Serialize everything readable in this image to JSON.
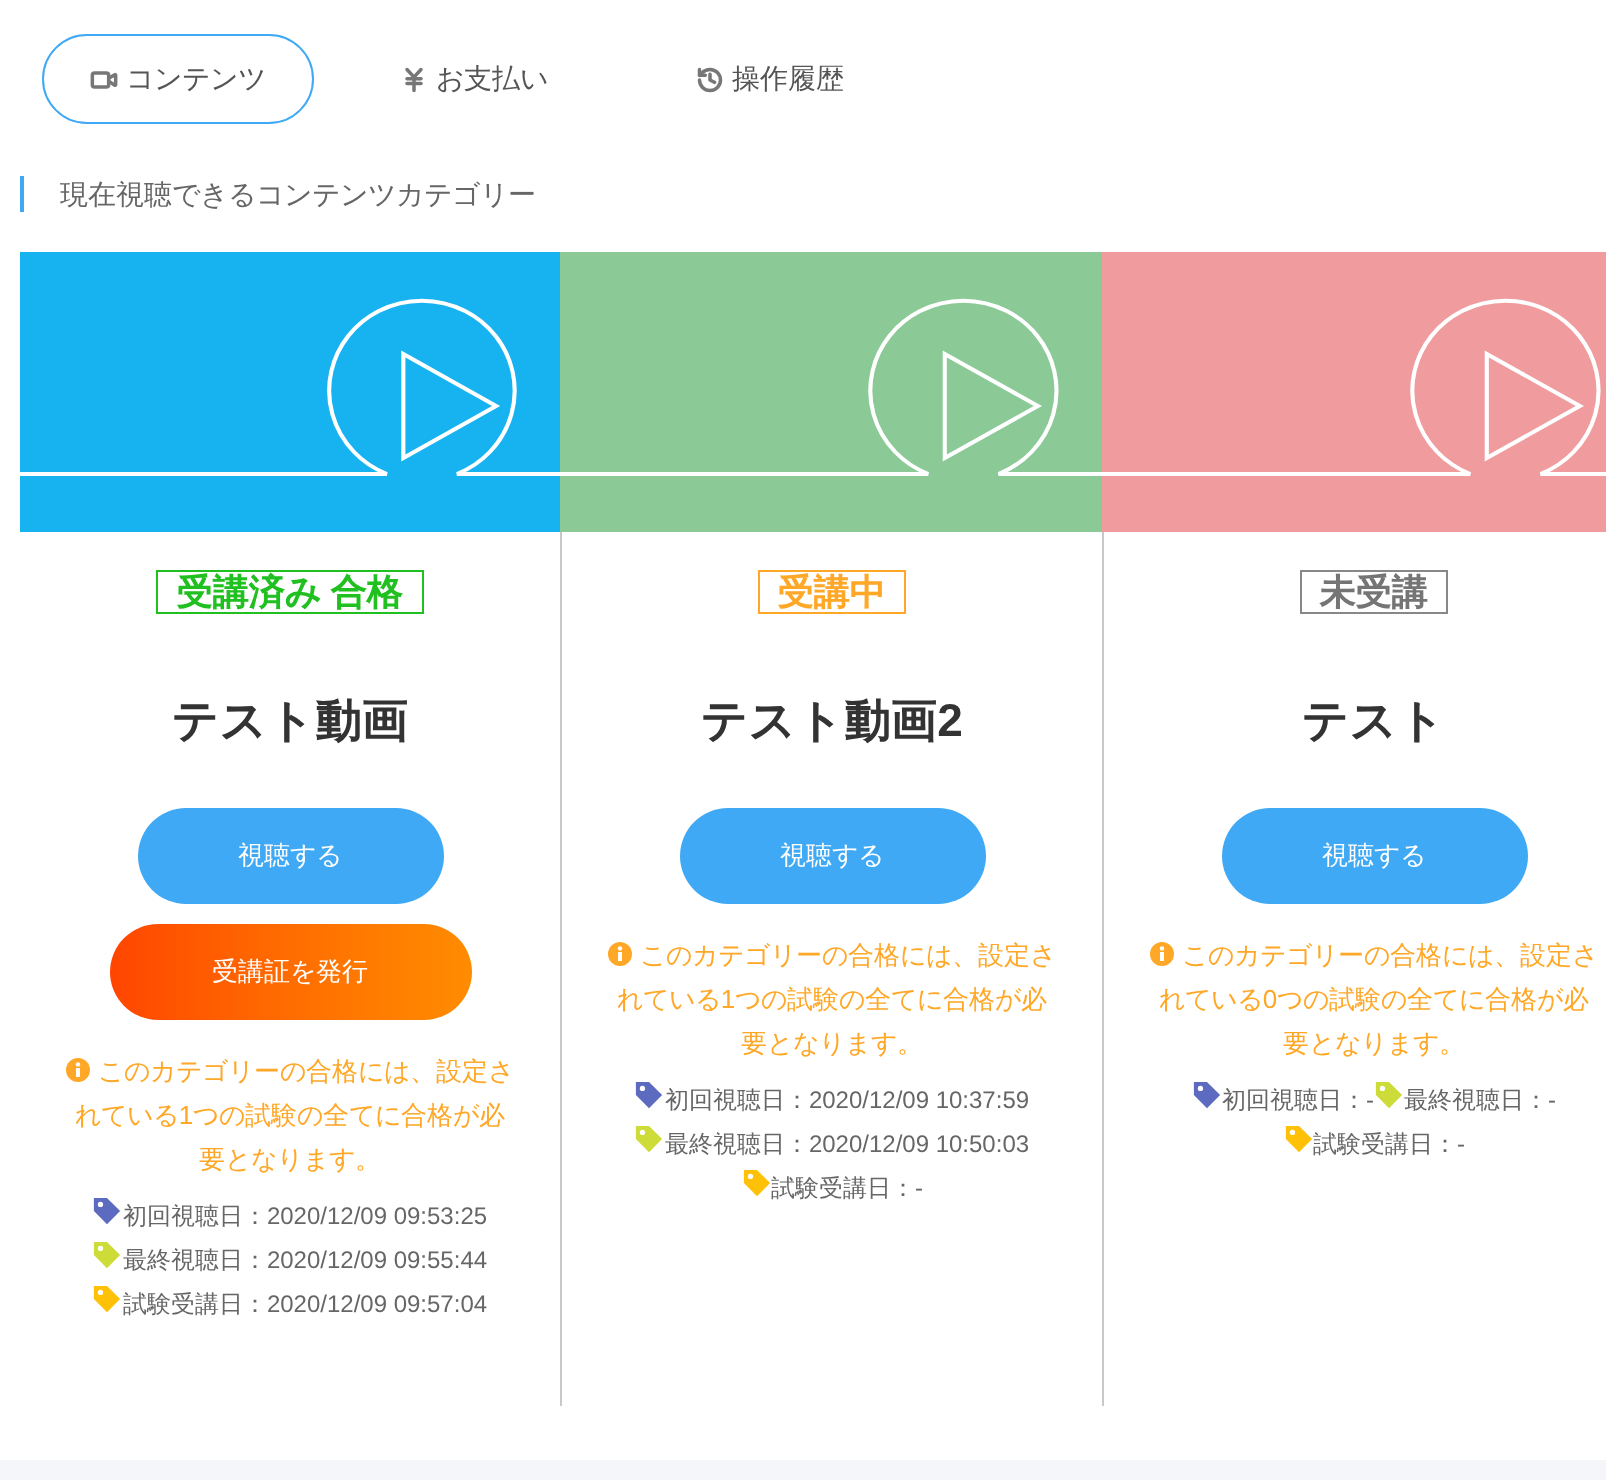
{
  "tabs": [
    {
      "label": "コンテンツ",
      "kind": "video",
      "selected": true
    },
    {
      "label": "お支払い",
      "kind": "yen",
      "selected": false
    },
    {
      "label": "操作履歴",
      "kind": "history",
      "selected": false
    }
  ],
  "section_title": "現在視聴できるコンテンツカテゴリー",
  "cards": [
    {
      "color": "#17b3f0",
      "status": {
        "kind": "passed",
        "label": "受講済み 合格"
      },
      "title": "テスト動画",
      "watch_button": "視聴する",
      "certificate_button": "受講証を発行",
      "note": "このカテゴリーの合格には、設定されている1つの試験の全てに合格が必要となります。",
      "dates": [
        {
          "kind": "first",
          "text": "初回視聴日：2020/12/09 09:53:25"
        },
        {
          "kind": "last",
          "text": "最終視聴日：2020/12/09 09:55:44"
        },
        {
          "kind": "exam",
          "text": "試験受講日：2020/12/09 09:57:04"
        }
      ]
    },
    {
      "color": "#8bc997",
      "status": {
        "kind": "in_progress",
        "label": "受講中"
      },
      "title": "テスト動画2",
      "watch_button": "視聴する",
      "note": "このカテゴリーの合格には、設定されている1つの試験の全てに合格が必要となります。",
      "dates": [
        {
          "kind": "first",
          "text": "初回視聴日：2020/12/09 10:37:59"
        },
        {
          "kind": "last",
          "text": "最終視聴日：2020/12/09 10:50:03"
        },
        {
          "kind": "exam",
          "text": "試験受講日：-"
        }
      ]
    },
    {
      "color": "#f09c9e",
      "status": {
        "kind": "not_started",
        "label": "未受講"
      },
      "title": "テスト",
      "watch_button": "視聴する",
      "note": "このカテゴリーの合格には、設定されている0つの試験の全てに合格が必要となります。",
      "dates": [
        {
          "kind": "first",
          "text": "初回視聴日：-"
        },
        {
          "kind": "last",
          "text": "最終視聴日：-"
        },
        {
          "kind": "exam",
          "text": "試験受講日：-"
        }
      ]
    }
  ]
}
